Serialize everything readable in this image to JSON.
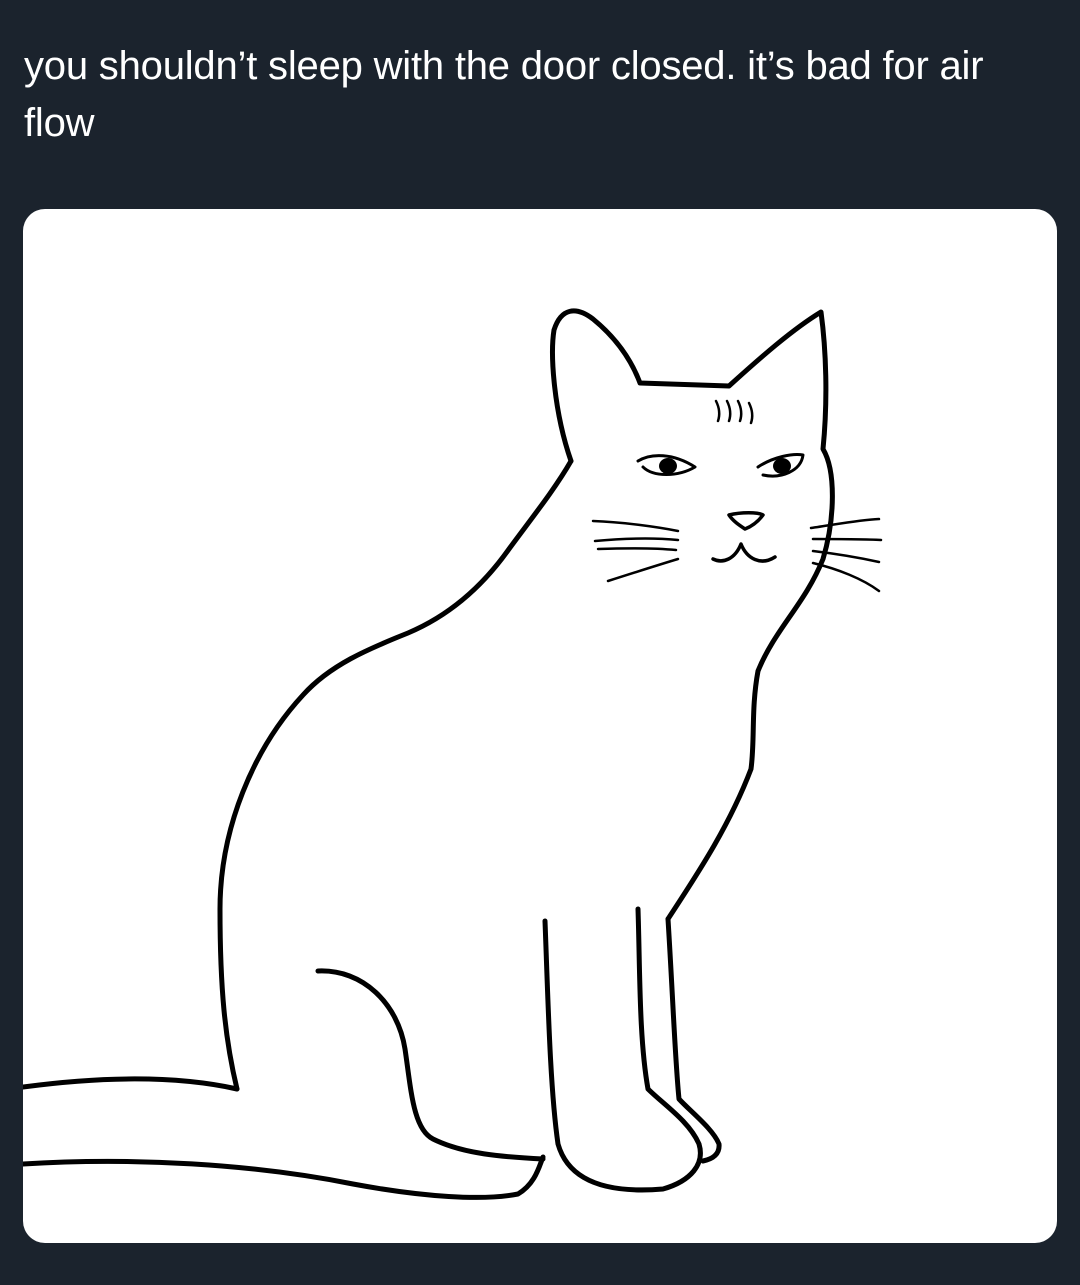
{
  "post": {
    "text": "you shouldn’t sleep with the door closed. it’s bad for air flow"
  },
  "media": {
    "kind": "drawing",
    "subject": "cat-illustration"
  },
  "colors": {
    "background": "#1b232d",
    "text": "#ffffff",
    "card": "#ffffff",
    "ink": "#000000"
  }
}
